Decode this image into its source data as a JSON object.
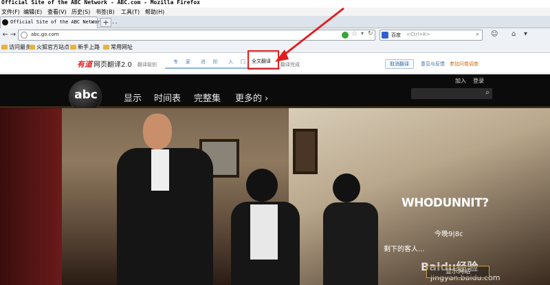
{
  "window": {
    "title": "Official Site of the ABC Network - ABC.com - Mozilla Firefox"
  },
  "menu": [
    "文件(F)",
    "编辑(E)",
    "查看(V)",
    "历史(S)",
    "书签(B)",
    "工具(T)",
    "帮助(H)"
  ],
  "tab": {
    "label": "Official Site of the ABC Network -...",
    "close": "×",
    "new": "+"
  },
  "nav": {
    "back": "←",
    "forward": "→",
    "url": "abc.go.com",
    "star": "☆",
    "dropdown": "▾",
    "reload": "↻",
    "search_engine": "百度",
    "search_placeholder": "<Ctrl+K>",
    "search_icon": "⌕",
    "right_icons": [
      "☺",
      "⌂",
      "▾"
    ]
  },
  "bookmarks": [
    "访问最多",
    "火狐官方站点",
    "新手上路",
    "常用网址"
  ],
  "youdao": {
    "logo": "有道",
    "title": "网页翻译2.0",
    "level_label": "翻译级别",
    "steps": [
      "专",
      "家",
      "进",
      "阶",
      "入",
      "门"
    ],
    "active": "全文翻译",
    "done": "翻译完成",
    "cancel": "取消翻译",
    "feedback": "意见与反馈",
    "survey": "参加问卷调查"
  },
  "site": {
    "logo": "abc",
    "nav": [
      "显示",
      "时间表",
      "完整集",
      "更多的 ›"
    ],
    "join": "加入",
    "login": "登录",
    "search_icon": "⌕",
    "hero": {
      "show": "WHODUNNIT?",
      "time": "今晚9|8c",
      "desc": "剩下的客人...",
      "button": "显示网站"
    },
    "watermark": "Baidu经验",
    "watermark_url": "jingyan.baidu.com"
  },
  "annotation_color": "#e21d1d"
}
